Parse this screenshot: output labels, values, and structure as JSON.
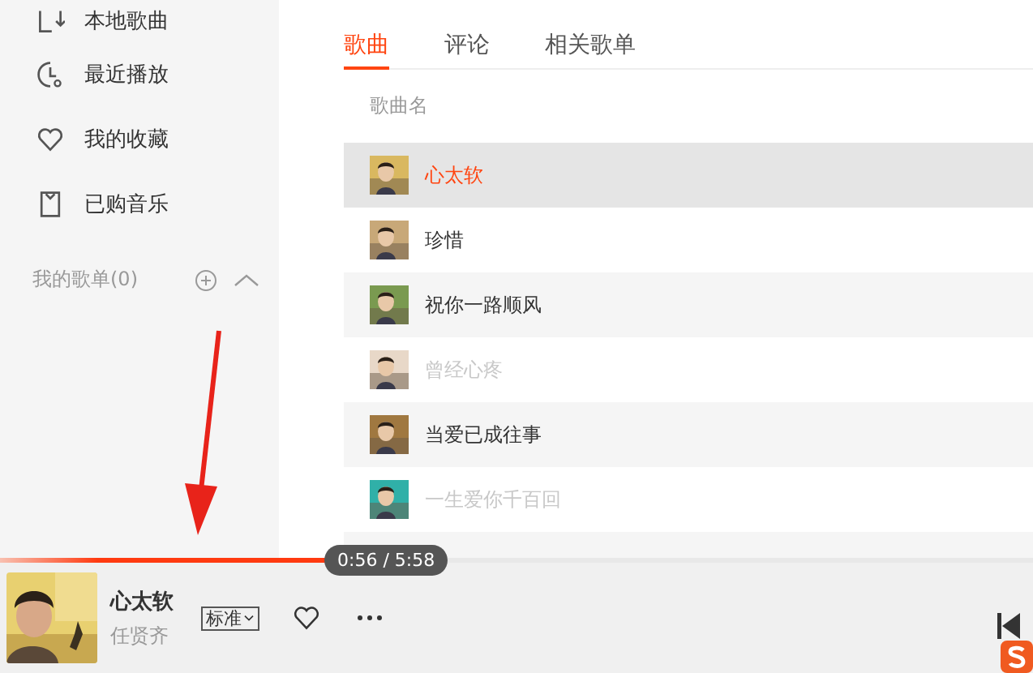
{
  "sidebar": {
    "items": [
      {
        "label": "本地歌曲"
      },
      {
        "label": "最近播放"
      },
      {
        "label": "我的收藏"
      },
      {
        "label": "已购音乐"
      }
    ],
    "section": {
      "title": "我的歌单(0)",
      "expanded": true
    }
  },
  "tabs": [
    {
      "label": "歌曲",
      "selected": true
    },
    {
      "label": "评论",
      "selected": false
    },
    {
      "label": "相关歌单",
      "selected": false
    }
  ],
  "song_list": {
    "column": "歌曲名",
    "rows": [
      {
        "title": "心太软",
        "selected": true,
        "disabled": false
      },
      {
        "title": "珍惜",
        "selected": false,
        "disabled": false
      },
      {
        "title": "祝你一路顺风",
        "selected": false,
        "disabled": false
      },
      {
        "title": "曾经心疼",
        "selected": false,
        "disabled": true
      },
      {
        "title": "当爱已成往事",
        "selected": false,
        "disabled": false
      },
      {
        "title": "一生爱你千百回",
        "selected": false,
        "disabled": true
      }
    ]
  },
  "player": {
    "title": "心太软",
    "artist": "任贤齐",
    "time": "0:56 / 5:58",
    "quality": "标准",
    "level": 0.315
  }
}
